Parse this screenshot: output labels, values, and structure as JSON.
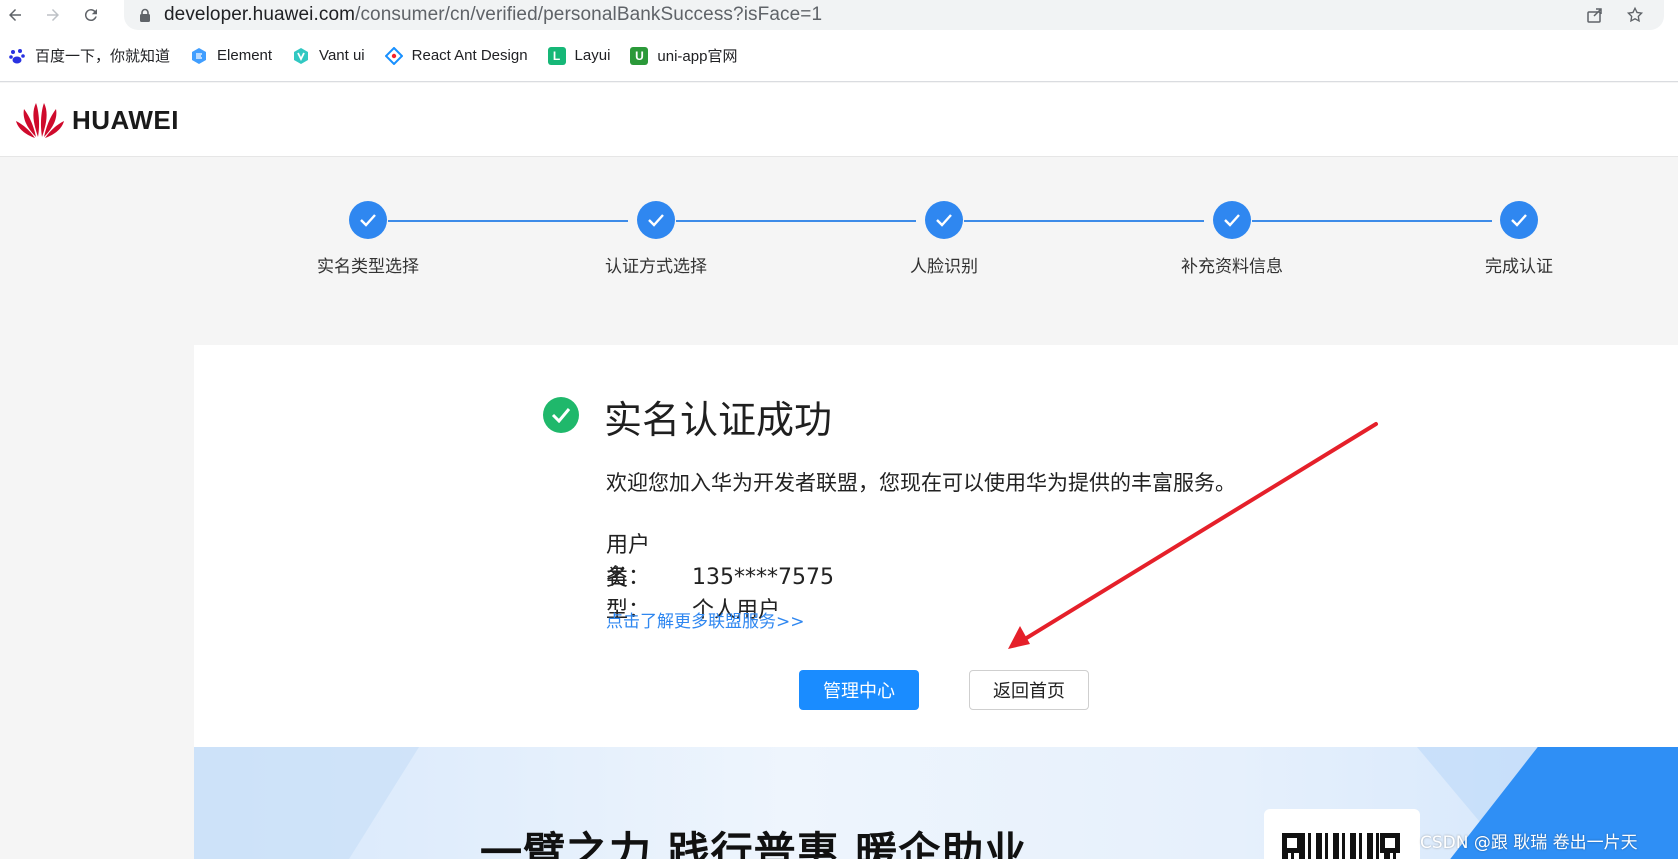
{
  "browser": {
    "url_host": "developer.huawei.com",
    "url_path": "/consumer/cn/verified/personalBankSuccess?isFace=1",
    "bookmarks": [
      {
        "label": "百度一下，你就知道",
        "icon": "baidu-icon",
        "color": "#2932e1"
      },
      {
        "label": "Element",
        "icon": "element-icon",
        "color": "#409eff"
      },
      {
        "label": "Vant ui",
        "icon": "vant-icon",
        "color": "#07c160"
      },
      {
        "label": "React Ant Design",
        "icon": "antd-icon",
        "color": "#1890ff"
      },
      {
        "label": "Layui",
        "icon": "layui-icon",
        "color": "#16b777"
      },
      {
        "label": "uni-app官网",
        "icon": "uniapp-icon",
        "color": "#2b9939"
      }
    ]
  },
  "header": {
    "logo_text": "HUAWEI",
    "brand_color": "#cf0a2c"
  },
  "steps": {
    "active_color": "#2f87f0",
    "items": [
      {
        "label": "实名类型选择",
        "done": true
      },
      {
        "label": "认证方式选择",
        "done": true
      },
      {
        "label": "人脸识别",
        "done": true
      },
      {
        "label": "补充资料信息",
        "done": true
      },
      {
        "label": "完成认证",
        "done": true
      }
    ]
  },
  "result": {
    "title": "实名认证成功",
    "welcome": "欢迎您加入华为开发者联盟，您现在可以使用华为提供的丰富服务。",
    "username_label": "用户名：",
    "username_value": "135****7575",
    "type_label": "类　型：",
    "type_value": "个人用户",
    "more_link": "点击了解更多联盟服务>>",
    "primary_button": "管理中心",
    "secondary_button": "返回首页"
  },
  "banner": {
    "slogan": "一臂之力  践行普惠  暖企助业"
  },
  "watermark": "CSDN @跟 耿瑞 卷出一片天"
}
